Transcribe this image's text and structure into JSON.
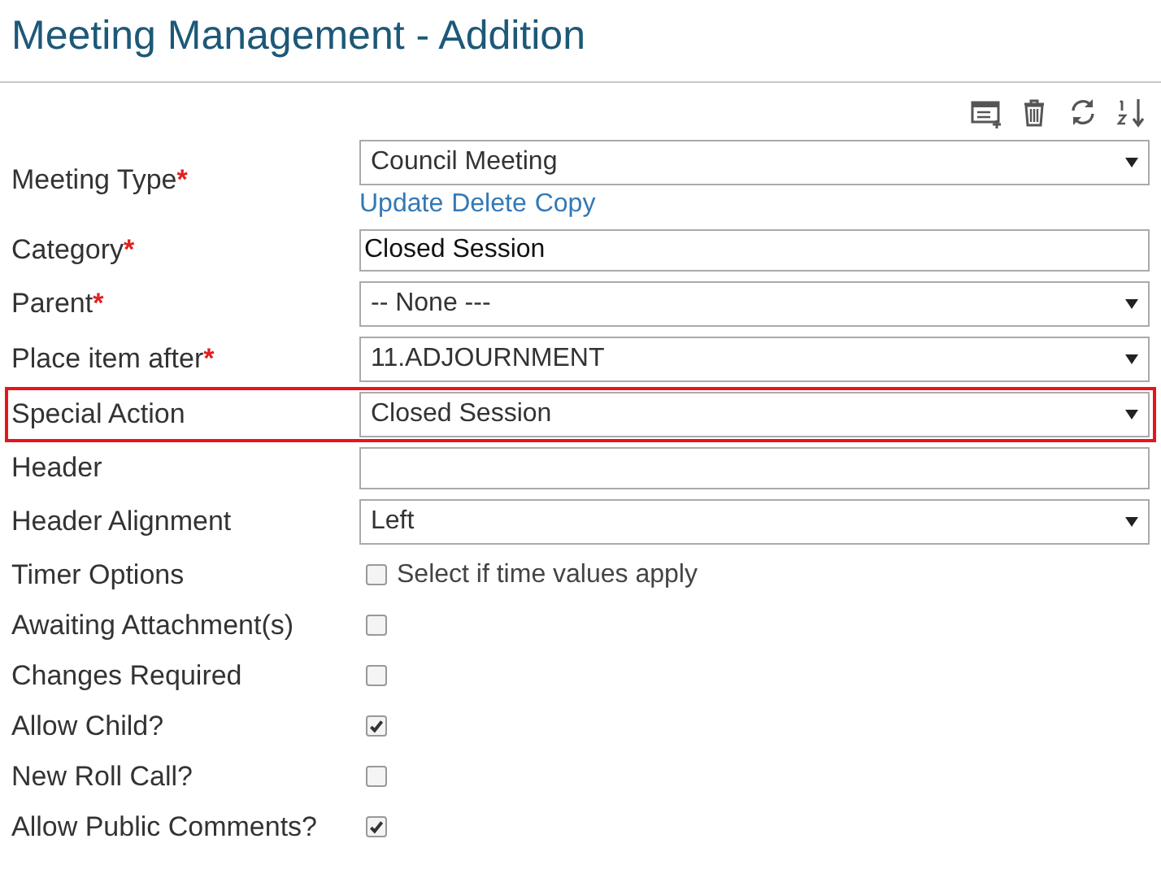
{
  "page_title": "Meeting Management - Addition",
  "toolbar": [
    {
      "kind": "list-add"
    },
    {
      "kind": "trash"
    },
    {
      "kind": "refresh"
    },
    {
      "kind": "sort"
    }
  ],
  "fields": [
    {
      "label": "Meeting Type",
      "required_mark": "*",
      "highlighted": false,
      "kind": "select",
      "value": "Council Meeting",
      "links": [
        "Update",
        "Delete",
        "Copy"
      ]
    },
    {
      "label": "Category",
      "required_mark": "*",
      "highlighted": false,
      "kind": "text",
      "value": "Closed Session"
    },
    {
      "label": "Parent",
      "required_mark": "*",
      "highlighted": false,
      "kind": "select",
      "value": "-- None ---"
    },
    {
      "label": "Place item after",
      "required_mark": "*",
      "highlighted": false,
      "kind": "select",
      "value": "11.ADJOURNMENT"
    },
    {
      "label": "Special Action",
      "highlighted": true,
      "kind": "select",
      "value": "Closed Session"
    },
    {
      "label": "Header",
      "highlighted": false,
      "kind": "text"
    },
    {
      "label": "Header Alignment",
      "highlighted": false,
      "kind": "select",
      "value": "Left"
    },
    {
      "label": "Timer Options",
      "highlighted": false,
      "kind": "checkbox",
      "checked": false,
      "caption": "Select if time values apply"
    },
    {
      "label": "Awaiting Attachment(s)",
      "highlighted": false,
      "kind": "checkbox",
      "checked": false
    },
    {
      "label": "Changes Required",
      "highlighted": false,
      "kind": "checkbox",
      "checked": false
    },
    {
      "label": "Allow Child?",
      "highlighted": false,
      "kind": "checkbox",
      "checked": true
    },
    {
      "label": "New Roll Call?",
      "highlighted": false,
      "kind": "checkbox",
      "checked": false
    },
    {
      "label": "Allow Public Comments?",
      "highlighted": false,
      "kind": "checkbox",
      "checked": true
    }
  ]
}
